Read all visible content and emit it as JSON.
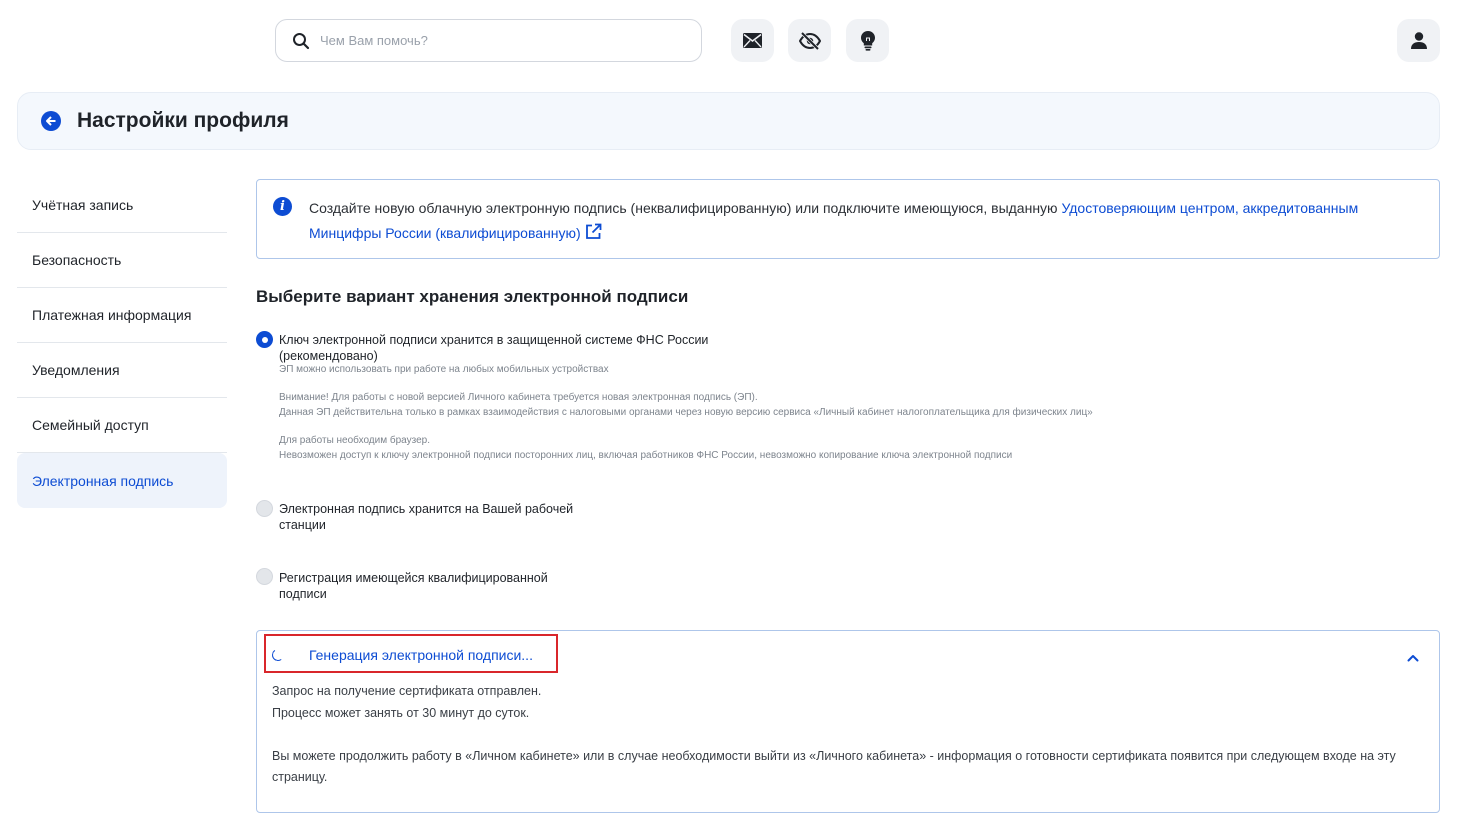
{
  "topbar": {
    "search_placeholder": "Чем Вам помочь?",
    "icons": [
      "search-icon",
      "mail-icon",
      "eye-off-icon",
      "lightbulb-icon",
      "user-icon"
    ]
  },
  "header": {
    "title": "Настройки профиля"
  },
  "sidebar": {
    "items": [
      {
        "label": "Учётная запись"
      },
      {
        "label": "Безопасность"
      },
      {
        "label": "Платежная информация"
      },
      {
        "label": "Уведомления"
      },
      {
        "label": "Семейный доступ"
      },
      {
        "label": "Электронная подпись",
        "active": true
      }
    ]
  },
  "info": {
    "text": "Создайте новую облачную электронную подпись (неквалифицированную) или подключите имеющуюся, выданную ",
    "link_text": "Удостоверяющим центром, аккредитованным Минцифры России (квалифицированную)"
  },
  "storage": {
    "title": "Выберите вариант хранения электронной подписи",
    "options": [
      {
        "label_line1": "Ключ электронной подписи хранится в защищенной системе ФНС России",
        "label_line2": "(рекомендовано)",
        "checked": true,
        "note1": "ЭП можно использовать при работе на любых мобильных устройствах",
        "note2a": "Внимание! Для работы с новой версией Личного кабинета требуется новая электронная подпись (ЭП).",
        "note2b": "Данная ЭП действительна только в рамках взаимодействия с налоговыми органами через новую версию сервиса «Личный кабинет налогоплательщика для физических лиц»",
        "note3a": "Для работы необходим браузер.",
        "note3b": "Невозможен доступ к ключу электронной подписи посторонних лиц, включая работников ФНС России, невозможно копирование ключа электронной подписи"
      },
      {
        "label_line1": "Электронная подпись хранится на Вашей рабочей",
        "label_line2": "станции",
        "checked": false
      },
      {
        "label_line1": "Регистрация имеющейся квалифицированной",
        "label_line2": "подписи",
        "checked": false
      }
    ]
  },
  "generation": {
    "title": "Генерация электронной подписи...",
    "line1": "Запрос на получение сертификата отправлен.",
    "line2": "Процесс может занять от 30 минут до суток.",
    "line3": "Вы можете продолжить работу в «Личном кабинете» или в случае необходимости выйти из «Личного кабинета» - информация о готовности сертификата появится при следующем входе на эту страницу."
  },
  "colors": {
    "accent": "#0d4cd3",
    "highlight": "#d9262b"
  }
}
